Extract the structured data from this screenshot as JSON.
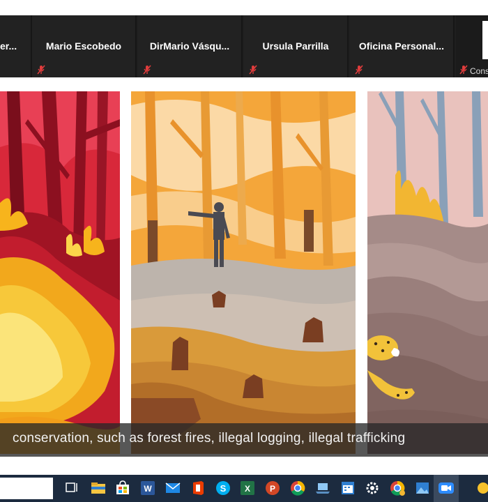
{
  "participants": [
    {
      "name": "er..."
    },
    {
      "name": "Mario Escobedo"
    },
    {
      "name": "DirMario  Vásqu..."
    },
    {
      "name": "Ursula Parrilla"
    },
    {
      "name": "Oficina  Personal..."
    },
    {
      "name": "Cons"
    }
  ],
  "caption": "conservation, such as forest fires, illegal logging, illegal trafficking",
  "taskbar": {
    "icons": [
      "task-view-icon",
      "file-explorer-icon",
      "store-icon",
      "word-icon",
      "mail-icon",
      "office-icon",
      "skype-icon",
      "excel-icon",
      "powerpoint-icon",
      "chrome-icon",
      "laptop-icon",
      "calendar-icon",
      "settings-icon",
      "chrome-profile-icon",
      "photos-icon",
      "zoom-icon",
      "notification-icon"
    ]
  }
}
